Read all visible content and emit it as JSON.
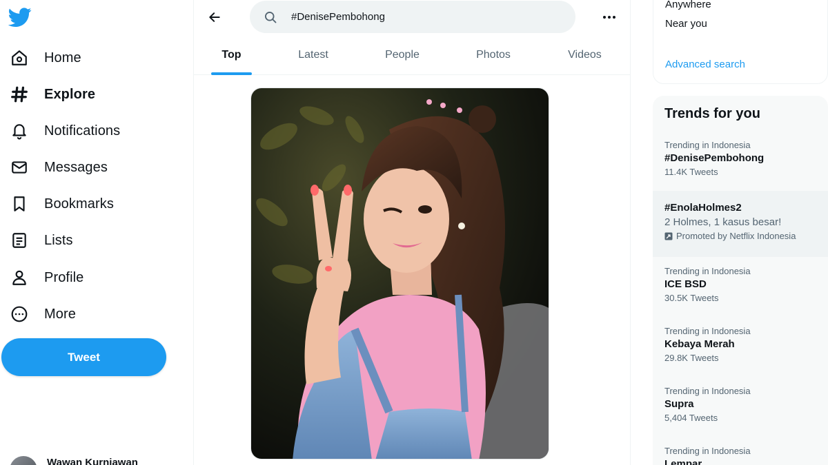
{
  "colors": {
    "accent": "#1d9bf0",
    "text": "#0f1419",
    "muted": "#536471"
  },
  "nav": {
    "logo_icon": "twitter-bird-icon",
    "items": [
      {
        "label": "Home",
        "icon": "home-icon"
      },
      {
        "label": "Explore",
        "icon": "hashtag-icon",
        "active": true
      },
      {
        "label": "Notifications",
        "icon": "bell-icon"
      },
      {
        "label": "Messages",
        "icon": "envelope-icon"
      },
      {
        "label": "Bookmarks",
        "icon": "bookmark-icon"
      },
      {
        "label": "Lists",
        "icon": "list-icon"
      },
      {
        "label": "Profile",
        "icon": "person-icon"
      },
      {
        "label": "More",
        "icon": "more-circle-icon"
      }
    ],
    "tweet_label": "Tweet",
    "account_name": "Wawan Kurniawan"
  },
  "search": {
    "value": "#DenisePembohong"
  },
  "tabs": [
    {
      "label": "Top",
      "active": true
    },
    {
      "label": "Latest"
    },
    {
      "label": "People"
    },
    {
      "label": "Photos"
    },
    {
      "label": "Videos"
    }
  ],
  "filters": {
    "location_options": [
      "Anywhere",
      "Near you"
    ],
    "advanced_search": "Advanced search"
  },
  "trends": {
    "title": "Trends for you",
    "items": [
      {
        "meta": "Trending in Indonesia",
        "name": "#DenisePembohong",
        "count": "11.4K Tweets"
      },
      {
        "name": "#EnolaHolmes2",
        "description": "2 Holmes, 1 kasus besar!",
        "promoted_by": "Promoted by Netflix Indonesia"
      },
      {
        "meta": "Trending in Indonesia",
        "name": "ICE BSD",
        "count": "30.5K Tweets"
      },
      {
        "meta": "Trending in Indonesia",
        "name": "Kebaya Merah",
        "count": "29.8K Tweets"
      },
      {
        "meta": "Trending in Indonesia",
        "name": "Supra",
        "count": "5,404 Tweets"
      },
      {
        "meta": "Trending in Indonesia",
        "name": "Lempar"
      }
    ]
  }
}
